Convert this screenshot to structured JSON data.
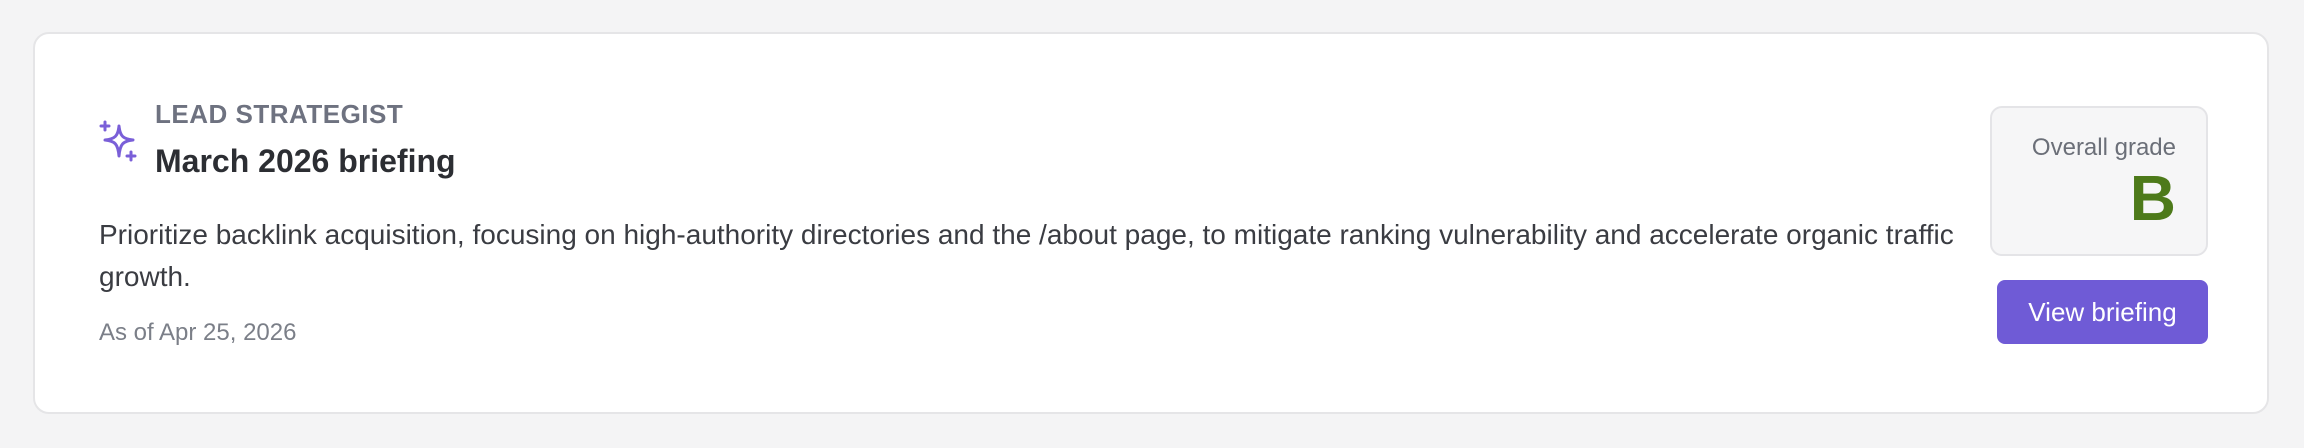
{
  "briefing": {
    "eyebrow": "LEAD STRATEGIST",
    "title": "March 2026 briefing",
    "description": "Prioritize backlink acquisition, focusing on high-authority directories and the /about page, to mitigate ranking vulnerability and accelerate organic traffic growth.",
    "as_of": "As of Apr 25, 2026",
    "icon": "sparkle-icon"
  },
  "grade": {
    "label": "Overall grade",
    "value": "B",
    "color": "#4d7a1a"
  },
  "actions": {
    "view_label": "View briefing",
    "accent": "#6f5bd6"
  }
}
